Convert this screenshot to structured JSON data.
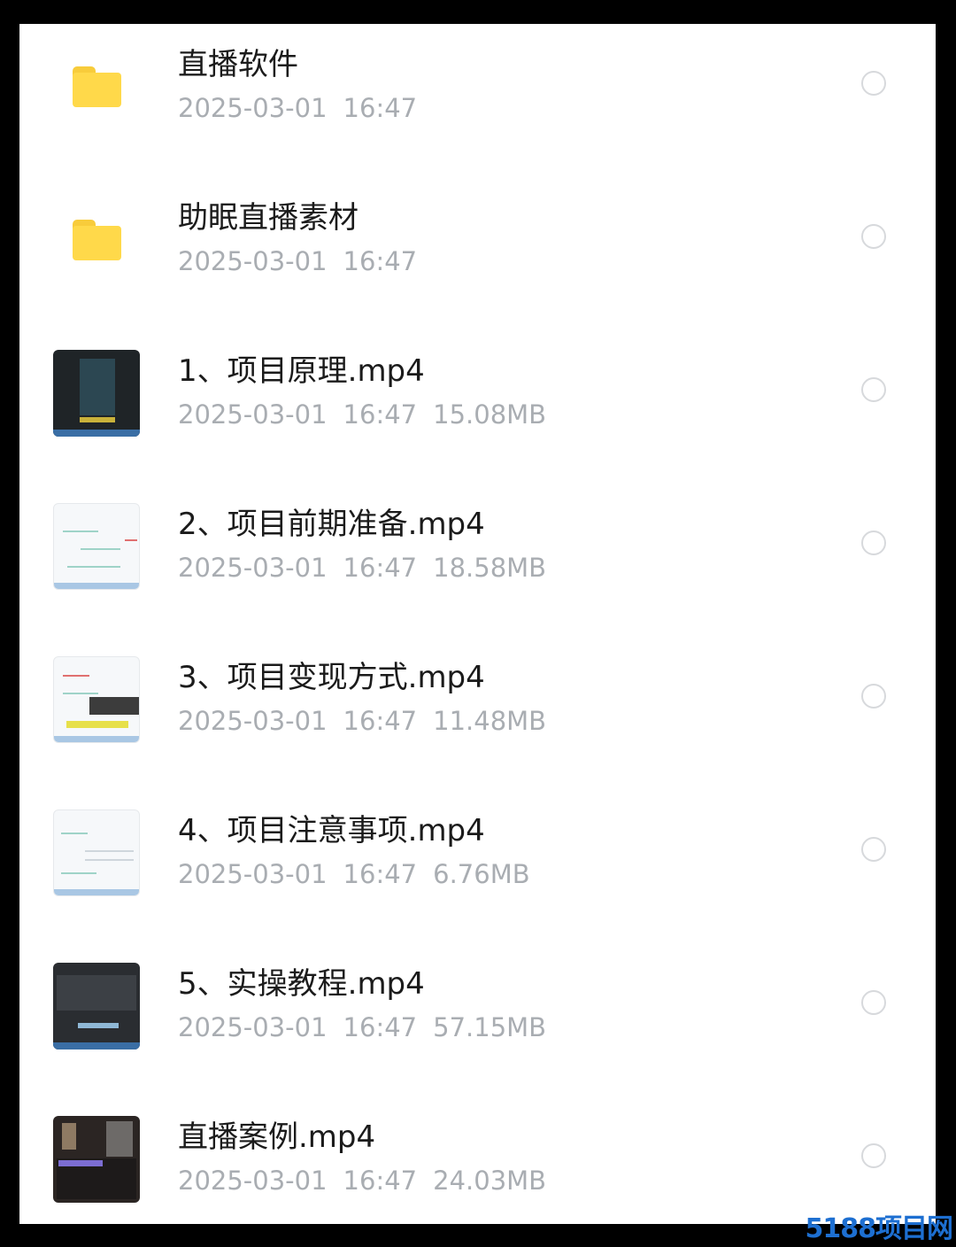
{
  "file_list": [
    {
      "name": "直播软件",
      "date": "2025-03-01",
      "time": "16:47",
      "size": "",
      "icon": "folder-icon"
    },
    {
      "name": "助眠直播素材",
      "date": "2025-03-01",
      "time": "16:47",
      "size": "",
      "icon": "folder-icon"
    },
    {
      "name": "1、项目原理.mp4",
      "date": "2025-03-01",
      "time": "16:47",
      "size": "15.08MB",
      "icon": "video-thumbnail"
    },
    {
      "name": "2、项目前期准备.mp4",
      "date": "2025-03-01",
      "time": "16:47",
      "size": "18.58MB",
      "icon": "video-thumbnail"
    },
    {
      "name": "3、项目变现方式.mp4",
      "date": "2025-03-01",
      "time": "16:47",
      "size": "11.48MB",
      "icon": "video-thumbnail"
    },
    {
      "name": "4、项目注意事项.mp4",
      "date": "2025-03-01",
      "time": "16:47",
      "size": "6.76MB",
      "icon": "video-thumbnail"
    },
    {
      "name": "5、实操教程.mp4",
      "date": "2025-03-01",
      "time": "16:47",
      "size": "57.15MB",
      "icon": "video-thumbnail"
    },
    {
      "name": "直播案例.mp4",
      "date": "2025-03-01",
      "time": "16:47",
      "size": "24.03MB",
      "icon": "video-thumbnail"
    }
  ],
  "colors": {
    "folder": "#ffd94a",
    "meta_text": "#a9adb2",
    "radio_border": "#d7d9dc",
    "watermark": "#1d6fd1"
  },
  "watermark": "5188项目网"
}
